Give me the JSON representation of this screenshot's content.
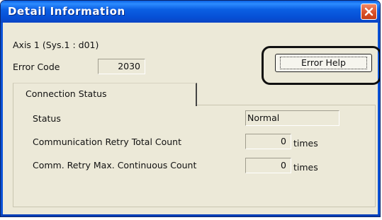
{
  "window": {
    "title": "Detail Information",
    "close_glyph": "✕"
  },
  "header": {
    "axis_label": "Axis  1 (Sys.1 : d01)",
    "error_code_label": "Error Code",
    "error_code_value": "2030"
  },
  "buttons": {
    "error_help_label": "Error Help"
  },
  "tab": {
    "label": "Connection Status"
  },
  "status_rows": {
    "status_label": "Status",
    "status_value": "Normal",
    "retry_total_label": "Communication Retry Total Count",
    "retry_total_value": "0",
    "retry_total_unit": "times",
    "retry_max_label": "Comm. Retry Max. Continuous Count",
    "retry_max_value": "0",
    "retry_max_unit": "times"
  },
  "colors": {
    "titlebar": "#0b5fe3",
    "window_bg": "#ece9d8",
    "close_button": "#d9512a"
  }
}
